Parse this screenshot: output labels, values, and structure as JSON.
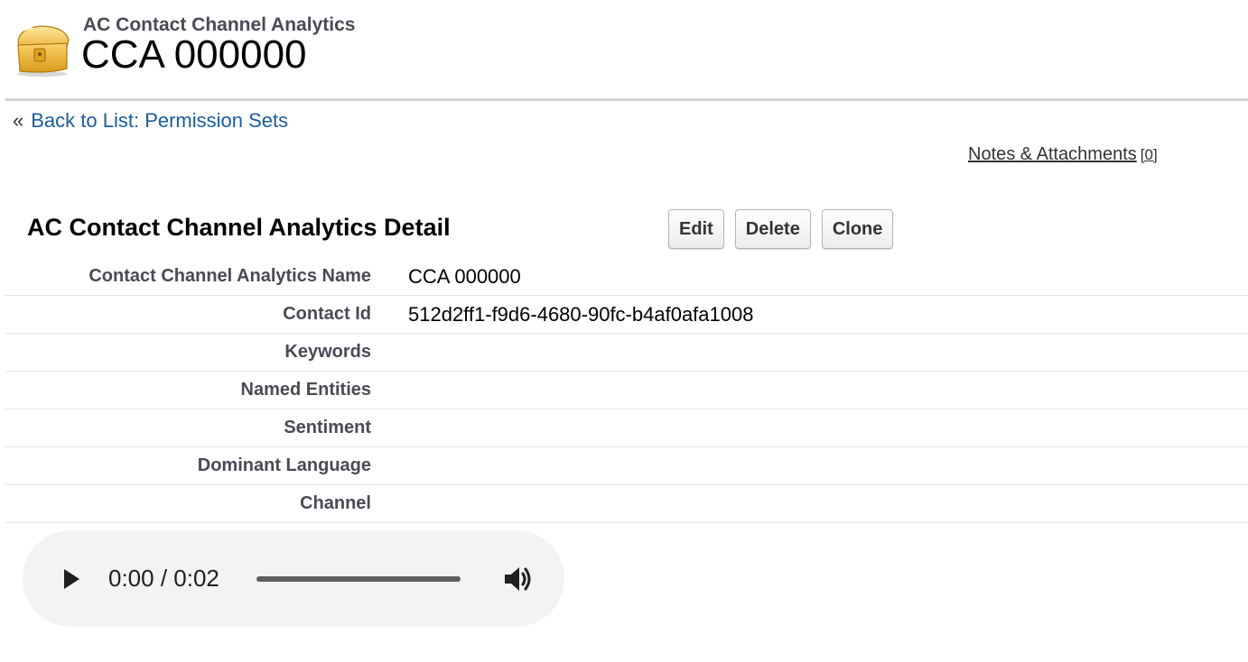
{
  "header": {
    "icon": "treasure-chest-icon",
    "object_type": "AC Contact Channel Analytics",
    "record_title": "CCA 000000"
  },
  "breadcrumb": {
    "prefix": "«",
    "link_text": "Back to List: Permission Sets"
  },
  "related": {
    "notes_label": "Notes & Attachments",
    "notes_count": "[0]"
  },
  "detail": {
    "title": "AC Contact Channel Analytics Detail",
    "buttons": {
      "edit": "Edit",
      "delete": "Delete",
      "clone": "Clone"
    },
    "fields": [
      {
        "label": "Contact Channel Analytics Name",
        "value": "CCA 000000"
      },
      {
        "label": "Contact Id",
        "value": "512d2ff1-f9d6-4680-90fc-b4af0afa1008"
      },
      {
        "label": "Keywords",
        "value": ""
      },
      {
        "label": "Named Entities",
        "value": ""
      },
      {
        "label": "Sentiment",
        "value": ""
      },
      {
        "label": "Dominant Language",
        "value": ""
      },
      {
        "label": "Channel",
        "value": ""
      }
    ]
  },
  "audio": {
    "time_display": "0:00 / 0:02",
    "progress": 0,
    "play_icon": "play-icon",
    "volume_icon": "volume-icon"
  },
  "colors": {
    "link": "#1a5c9e",
    "label": "#4a4a56",
    "rule": "#d4d4d4",
    "player_bg": "#f1f3f4"
  }
}
